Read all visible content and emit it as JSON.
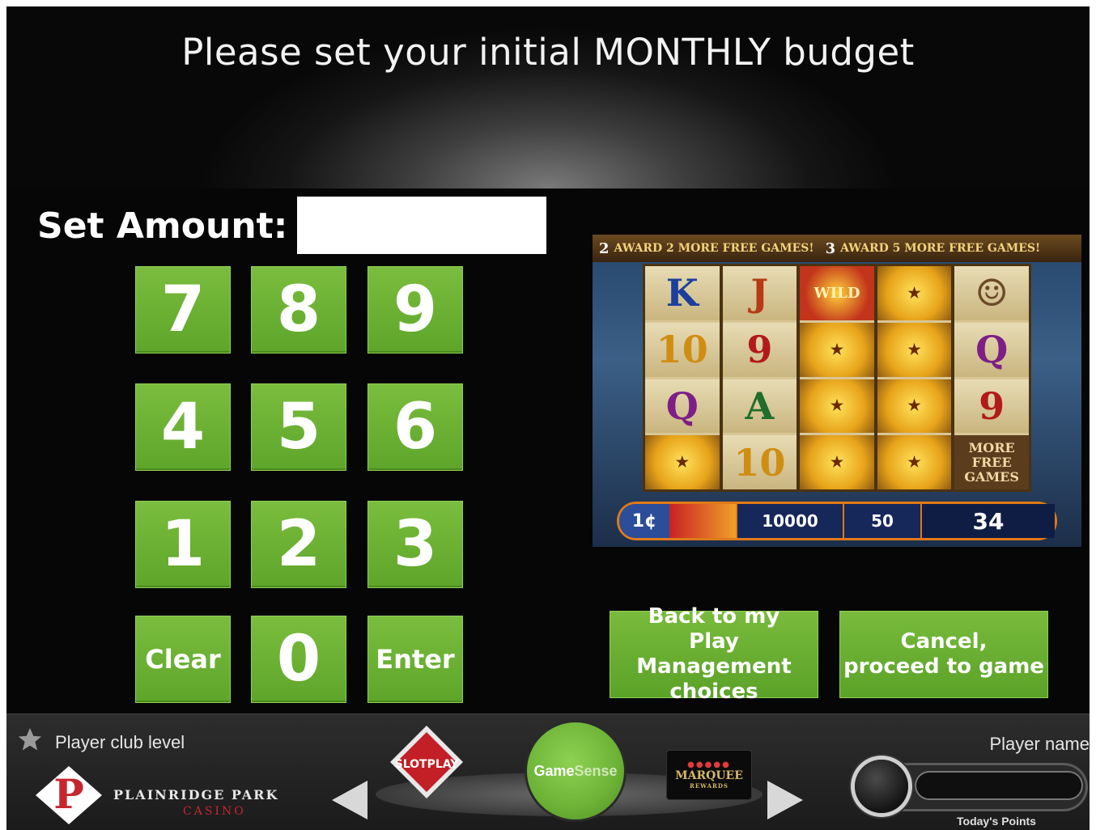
{
  "title": "Please set your initial MONTHLY budget",
  "set_amount_label": "Set Amount:",
  "amount_value": "",
  "keypad": {
    "k7": "7",
    "k8": "8",
    "k9": "9",
    "k4": "4",
    "k5": "5",
    "k6": "6",
    "k1": "1",
    "k2": "2",
    "k3": "3",
    "clear": "Clear",
    "k0": "0",
    "enter": "Enter"
  },
  "buttons": {
    "back": "Back to my\nPlay Management\nchoices",
    "cancel": "Cancel,\nproceed to game"
  },
  "game_preview": {
    "banner_left_num": "2",
    "banner_left_text": "AWARD 2 MORE FREE GAMES!",
    "banner_right_num": "3",
    "banner_right_text": "AWARD 5 MORE FREE GAMES!",
    "reels": [
      [
        "K",
        "10",
        "Q",
        "★"
      ],
      [
        "J",
        "9",
        "A",
        "10"
      ],
      [
        "WILD",
        "★",
        "★",
        "★"
      ],
      [
        "★",
        "★",
        "★",
        "★"
      ],
      [
        "☺",
        "Q",
        "9",
        "MORE FREE GAMES"
      ]
    ],
    "denom": "1¢",
    "credit": "10000",
    "bet": "50",
    "win": "34"
  },
  "bottom_bar": {
    "club_level_label": "Player club level",
    "casino_name": "PLAINRIDGE PARK",
    "casino_sub": "CASINO",
    "slotplay": "SLOTPLAY",
    "gamesense_game": "Game",
    "gamesense_sense": "Sense",
    "marquee": "MARQUEE",
    "marquee_rewards": "REWARDS",
    "player_name_label": "Player name",
    "todays_points_label": "Today's Points"
  },
  "colors": {
    "key_green": "#6cb236",
    "background": "#060606",
    "casino_red": "#c6262e"
  },
  "icons": [
    "star-icon",
    "arrow-left-icon",
    "arrow-right-icon",
    "casino-logo-icon"
  ]
}
